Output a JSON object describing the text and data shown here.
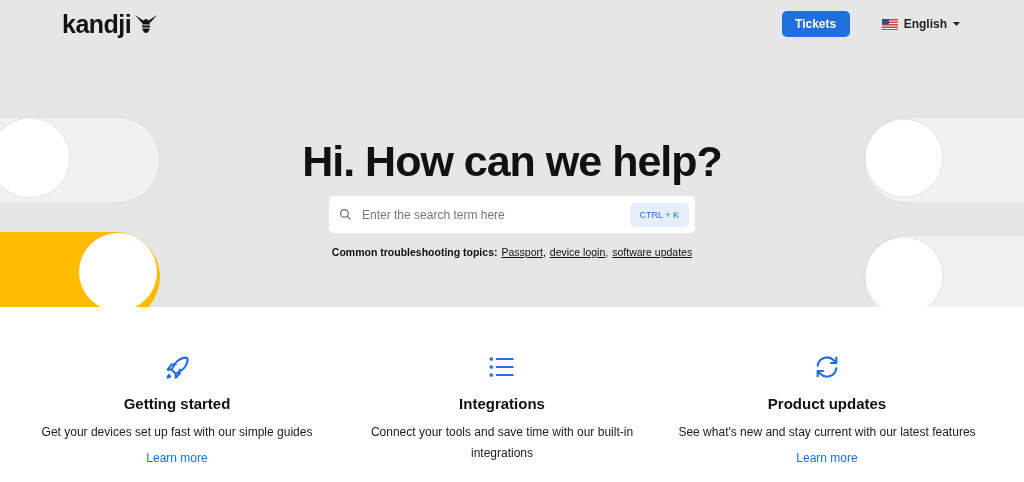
{
  "header": {
    "logo": "kandji",
    "tickets_button": "Tickets",
    "language": "English"
  },
  "hero": {
    "title": "Hi. How can we help?",
    "search": {
      "placeholder": "Enter the search term here",
      "shortcut": "CTRL + K"
    },
    "topics_label": "Common troubleshooting topics:",
    "topics": [
      "Passport",
      "device login",
      "software updates"
    ],
    "separator": ","
  },
  "cards": [
    {
      "kind": "rocket",
      "title": "Getting started",
      "description": "Get your devices set up fast with our simple guides",
      "link": "Learn more"
    },
    {
      "kind": "list",
      "title": "Integrations",
      "description": "Connect your tools and save time with our built-in integrations"
    },
    {
      "kind": "refresh",
      "title": "Product updates",
      "description": "See what's new and stay current with our latest features",
      "link": "Learn more"
    }
  ]
}
